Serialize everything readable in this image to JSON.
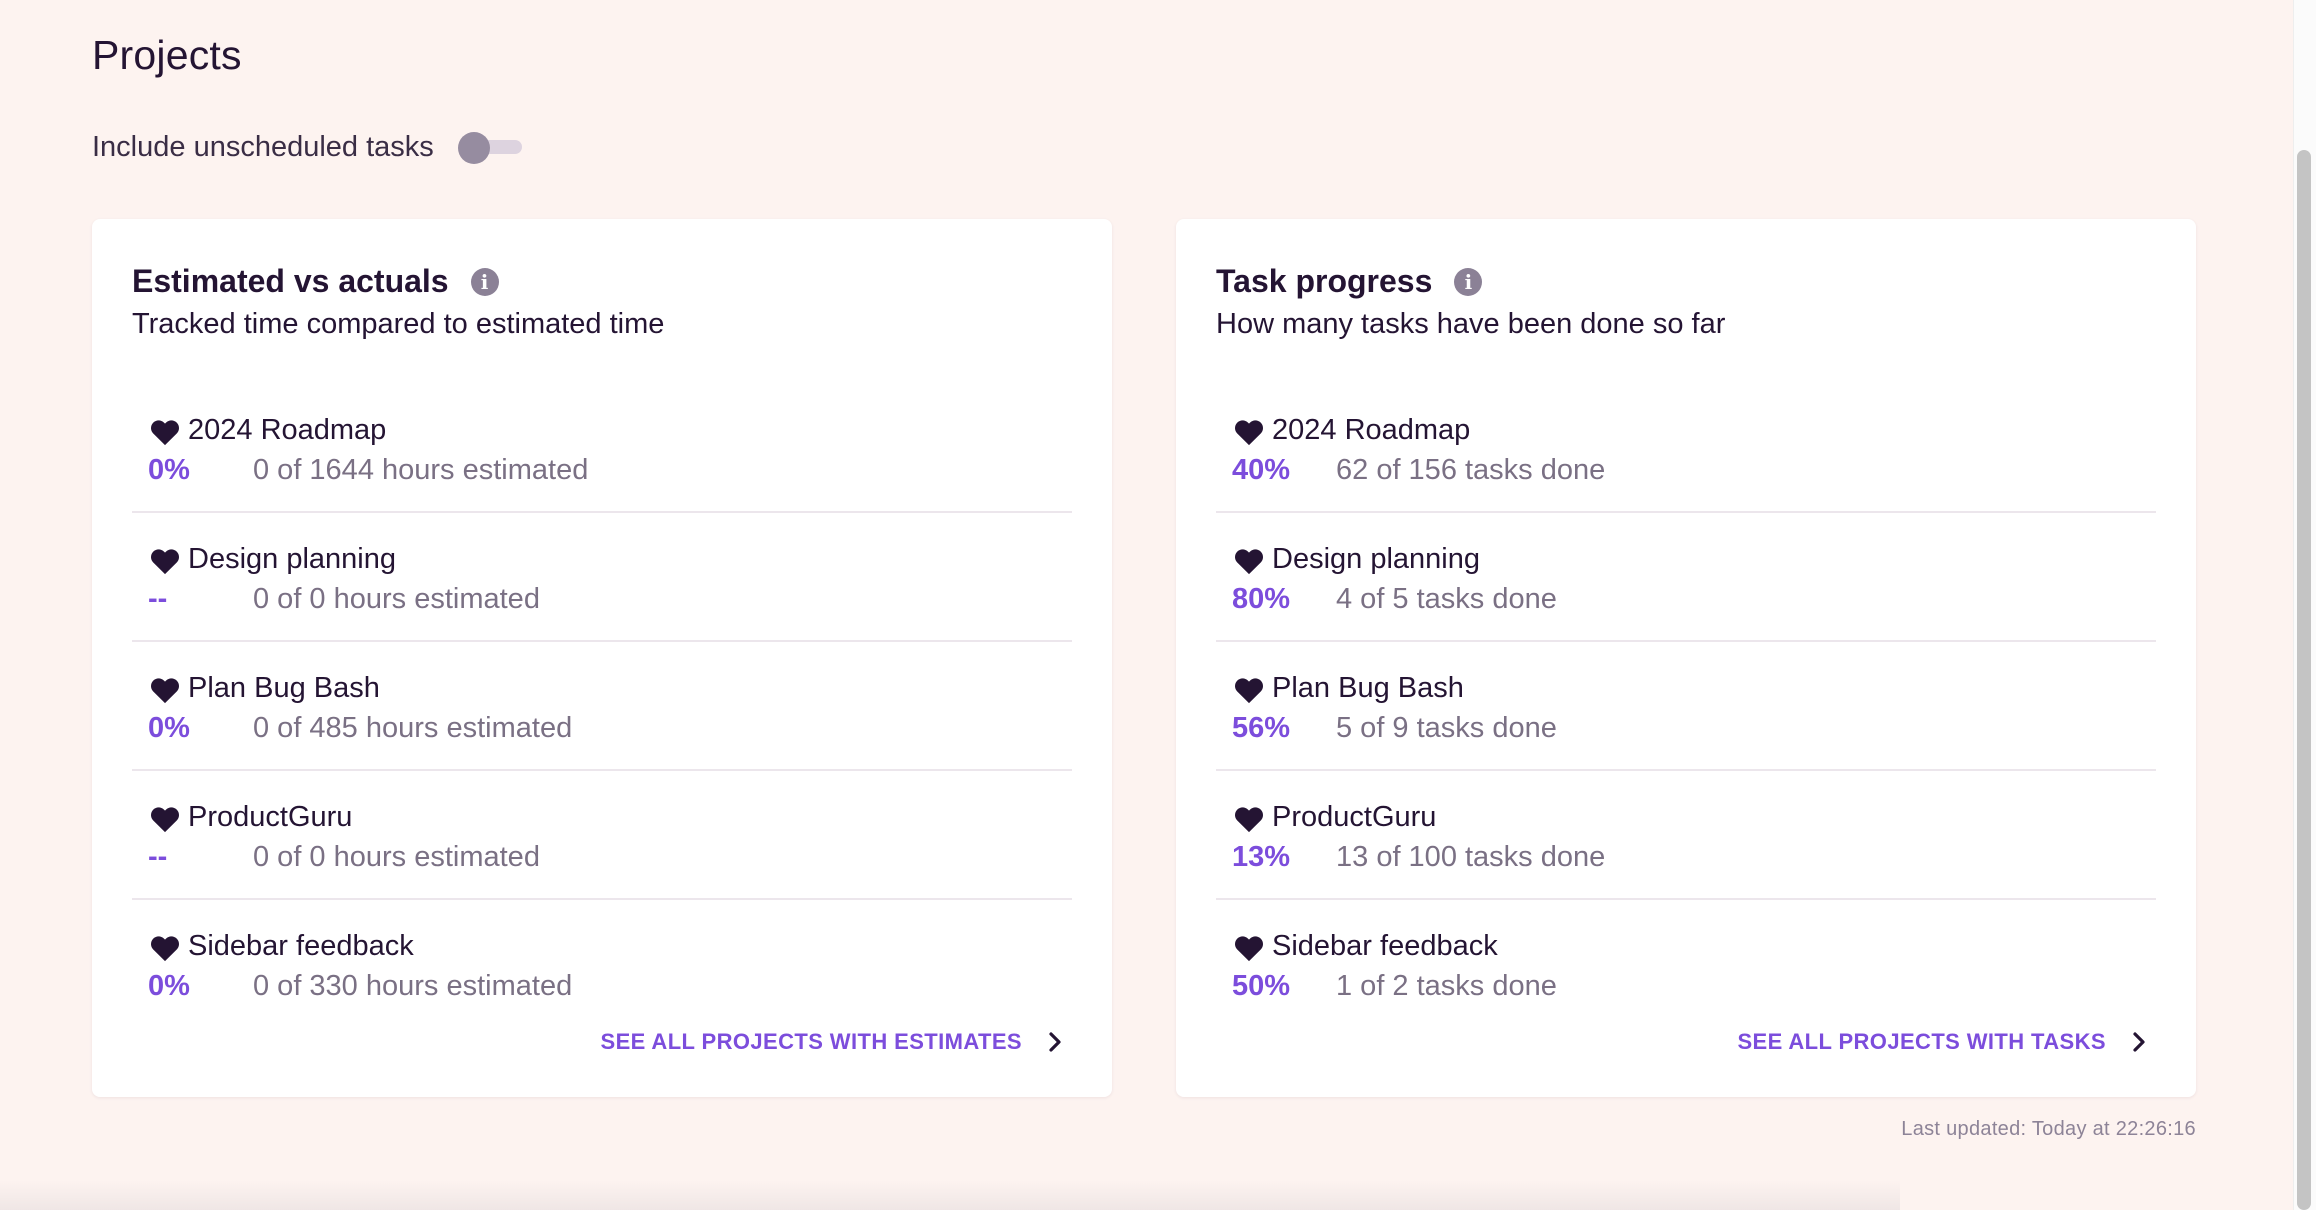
{
  "page": {
    "title": "Projects"
  },
  "toggle": {
    "label": "Include unscheduled tasks",
    "checked": false
  },
  "colors": {
    "background": "#fdf3f0",
    "accent": "#7c4ddc",
    "text": "#241433",
    "muted": "#7a7084"
  },
  "estimates": {
    "title": "Estimated vs actuals",
    "subtitle": "Tracked time compared to estimated time",
    "info_icon": "info-icon",
    "items": [
      {
        "icon": "heart-icon",
        "name": "2024 Roadmap",
        "pct": "0%",
        "detail": "0 of 1644 hours estimated"
      },
      {
        "icon": "heart-icon",
        "name": "Design planning",
        "pct": "--",
        "detail": "0 of 0 hours estimated"
      },
      {
        "icon": "heart-icon",
        "name": "Plan Bug Bash",
        "pct": "0%",
        "detail": "0 of 485 hours estimated"
      },
      {
        "icon": "heart-icon",
        "name": "ProductGuru",
        "pct": "--",
        "detail": "0 of 0 hours estimated"
      },
      {
        "icon": "heart-icon",
        "name": "Sidebar feedback",
        "pct": "0%",
        "detail": "0 of 330 hours estimated"
      }
    ],
    "see_all_label": "SEE ALL PROJECTS WITH ESTIMATES"
  },
  "tasks": {
    "title": "Task progress",
    "subtitle": "How many tasks have been done so far",
    "info_icon": "info-icon",
    "items": [
      {
        "icon": "heart-icon",
        "name": "2024 Roadmap",
        "pct": "40%",
        "detail": "62 of 156 tasks done"
      },
      {
        "icon": "heart-icon",
        "name": "Design planning",
        "pct": "80%",
        "detail": "4 of 5 tasks done"
      },
      {
        "icon": "heart-icon",
        "name": "Plan Bug Bash",
        "pct": "56%",
        "detail": "5 of 9 tasks done"
      },
      {
        "icon": "heart-icon",
        "name": "ProductGuru",
        "pct": "13%",
        "detail": "13 of 100 tasks done"
      },
      {
        "icon": "heart-icon",
        "name": "Sidebar feedback",
        "pct": "50%",
        "detail": "1 of 2 tasks done"
      }
    ],
    "see_all_label": "SEE ALL PROJECTS WITH TASKS"
  },
  "footer": {
    "last_updated": "Last updated: Today at 22:26:16"
  }
}
